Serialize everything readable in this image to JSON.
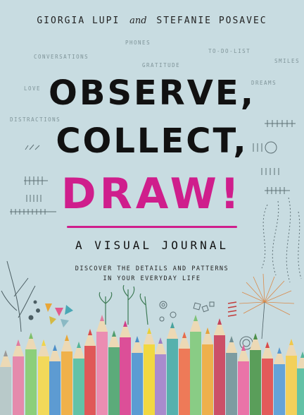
{
  "cover": {
    "authors": {
      "first": "GIORGIA LUPI",
      "and": "and",
      "second": "STEFANIE POSAVEC"
    },
    "title_line1": "OBSERVE,",
    "title_line2": "COLLECT,",
    "title_line3": "DRAW!",
    "subtitle": "A VISUAL JOURNAL",
    "tagline_line1": "DISCOVER THE DETAILS AND PATTERNS",
    "tagline_line2": "IN YOUR EVERYDAY LIFE",
    "background_words": {
      "phones": "PHONES",
      "conversations": "CONVERSATIONS",
      "to_do_list": "TO-DO-LIST",
      "gratitude": "GRATITUDE",
      "smiles": "SMILES",
      "love": "LOVE",
      "dreams": "DREAMS",
      "distractions": "DISTRACTIONS"
    },
    "colors": {
      "background": "#c8dce1",
      "title": "#111111",
      "accent": "#cf1e8c"
    }
  }
}
